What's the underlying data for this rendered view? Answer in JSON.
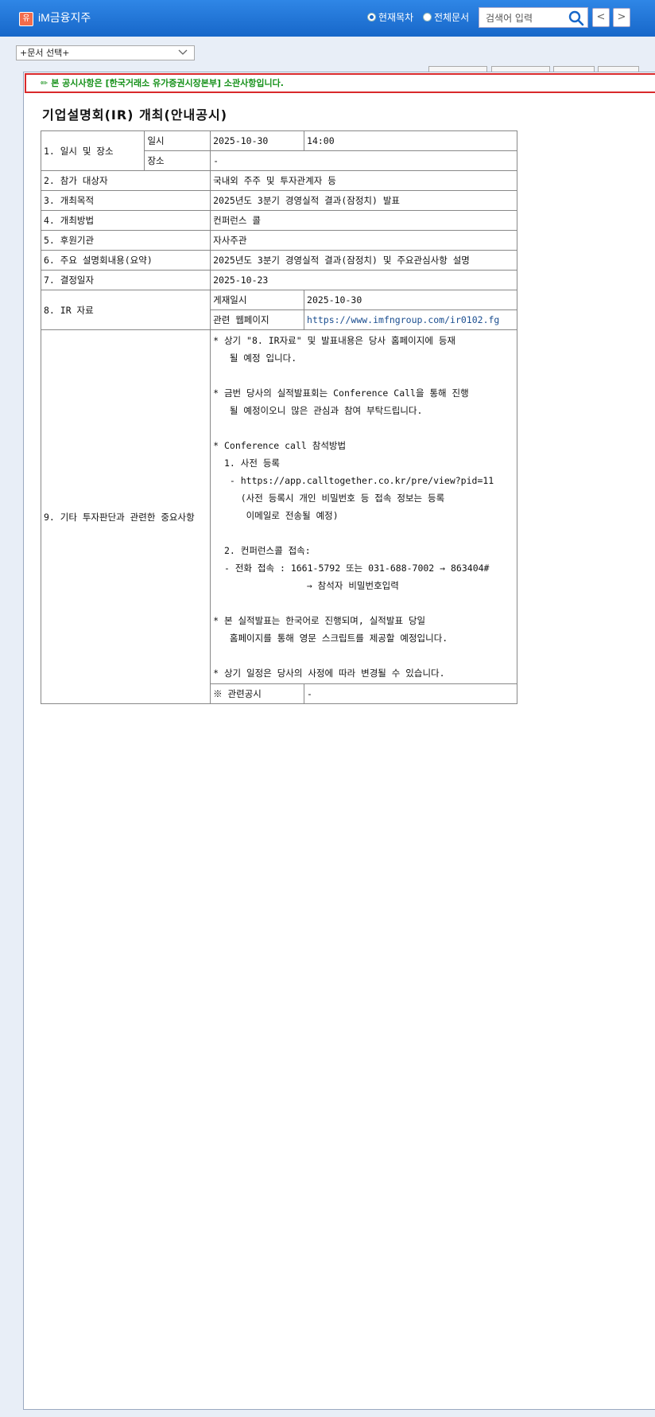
{
  "header": {
    "logo_glyph": "유",
    "company": "iM금융지주",
    "radio_current": "현재목차",
    "radio_all": "전체문서",
    "search_placeholder": "검색어 입력",
    "prev": "<",
    "next": ">"
  },
  "toolbar": {
    "doc_select": "+문서 선택+"
  },
  "notice": "본 공시사항은 [한국거래소 유가증권시장본부] 소관사항입니다.",
  "title": "기업설명회(IR) 개최(안내공시)",
  "table": {
    "r1_label": "1. 일시 및 장소",
    "r1_sub1": "일시",
    "r1_date": "2025-10-30",
    "r1_time": "14:00",
    "r1_sub2": "장소",
    "r1_place": "-",
    "r2_label": "2. 참가 대상자",
    "r2_value": "국내외 주주 및 투자관계자 등",
    "r3_label": "3. 개최목적",
    "r3_value": "2025년도 3분기 경영실적 결과(잠정치) 발표",
    "r4_label": "4. 개최방법",
    "r4_value": "컨퍼런스 콜",
    "r5_label": "5. 후원기관",
    "r5_value": "자사주관",
    "r6_label": "6. 주요 설명회내용(요약)",
    "r6_value": "2025년도 3분기 경영실적 결과(잠정치) 및 주요관심사항 설명",
    "r7_label": "7. 결정일자",
    "r7_value": "2025-10-23",
    "r8_label": "8. IR 자료",
    "r8_sub1": "게재일시",
    "r8_date": "2025-10-30",
    "r8_sub2": "관련 웹페이지",
    "r8_url": "https://www.imfngroup.com/ir0102.fg",
    "r9_label": "9. 기타 투자판단과 관련한 중요사항",
    "r9_text": "* 상기 \"8. IR자료\" 및 발표내용은 당사 홈페이지에 등재\n   될 예정 입니다.\n\n* 금번 당사의 실적발표회는 Conference Call을 통해 진행\n   될 예정이오니 많은 관심과 참여 부탁드립니다.\n\n* Conference call 참석방법\n  1. 사전 등록\n   - https://app.calltogether.co.kr/pre/view?pid=11\n     (사전 등록시 개인 비밀번호 등 접속 정보는 등록\n      이메일로 전송될 예정)\n\n  2. 컨퍼런스콜 접속:\n  - 전화 접속 : 1661-5792 또는 031-688-7002 → 863404#\n                 → 참석자 비밀번호입력\n\n* 본 실적발표는 한국어로 진행되며, 실적발표 당일\n   홈페이지를 통해 영문 스크립트를 제공할 예정입니다.\n\n* 상기 일정은 당사의 사정에 따라 변경될 수 있습니다.",
    "r10_label": "※ 관련공시",
    "r10_value": "-"
  }
}
